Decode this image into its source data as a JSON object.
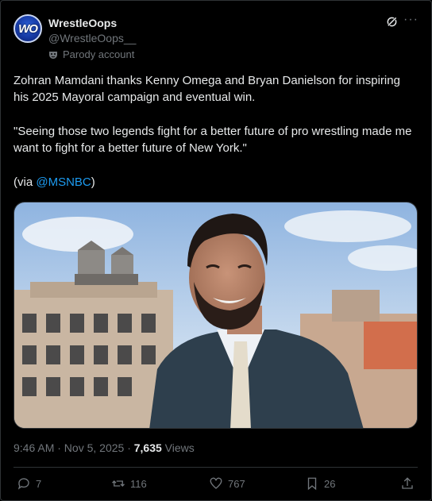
{
  "author": {
    "display_name": "WrestleOops",
    "handle": "@WrestleOops__",
    "badge": "Parody account",
    "avatar_text": "WO"
  },
  "post": {
    "paragraphs": [
      "Zohran Mamdani thanks Kenny Omega and Bryan Danielson for inspiring his 2025 Mayoral campaign and eventual win.",
      "\"Seeing those two legends fight for a better future of pro wrestling made me want to fight for a better future of New York.\""
    ],
    "via_prefix": "(via ",
    "via_mention": "@MSNBC",
    "via_suffix": ")"
  },
  "meta": {
    "timestamp": "9:46 AM · Nov 5, 2025 · ",
    "views_count": "7,635",
    "views_label": " Views"
  },
  "actions": {
    "replies": "7",
    "reposts": "116",
    "likes": "767",
    "bookmarks": "26"
  },
  "colors": {
    "background": "#000000",
    "text": "#e7e9ea",
    "muted": "#71767b",
    "link": "#1d9bf0",
    "divider": "#2f3336"
  },
  "icons": [
    "grok-icon",
    "more-icon",
    "parody-mask-icon",
    "reply-icon",
    "repost-icon",
    "like-icon",
    "bookmark-icon",
    "share-icon"
  ]
}
